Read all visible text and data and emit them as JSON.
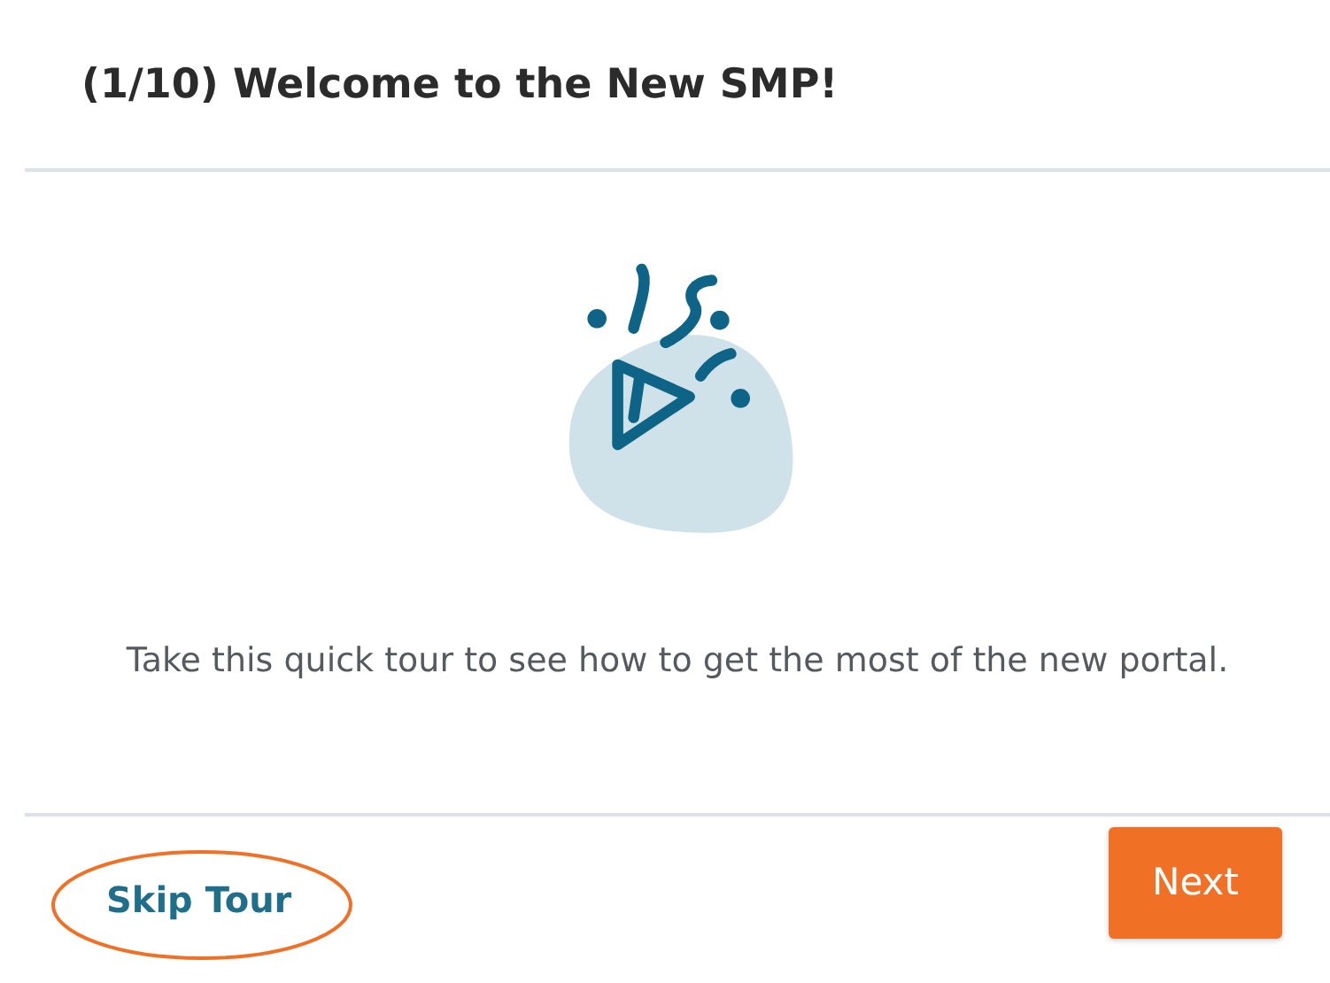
{
  "dialog": {
    "title": "(1/10) Welcome to the New SMP!",
    "message": "Take this quick tour to see how to get the most of the new portal.",
    "skip_button": {
      "label": "Skip Tour"
    },
    "next_button": {
      "label": "Next"
    }
  }
}
